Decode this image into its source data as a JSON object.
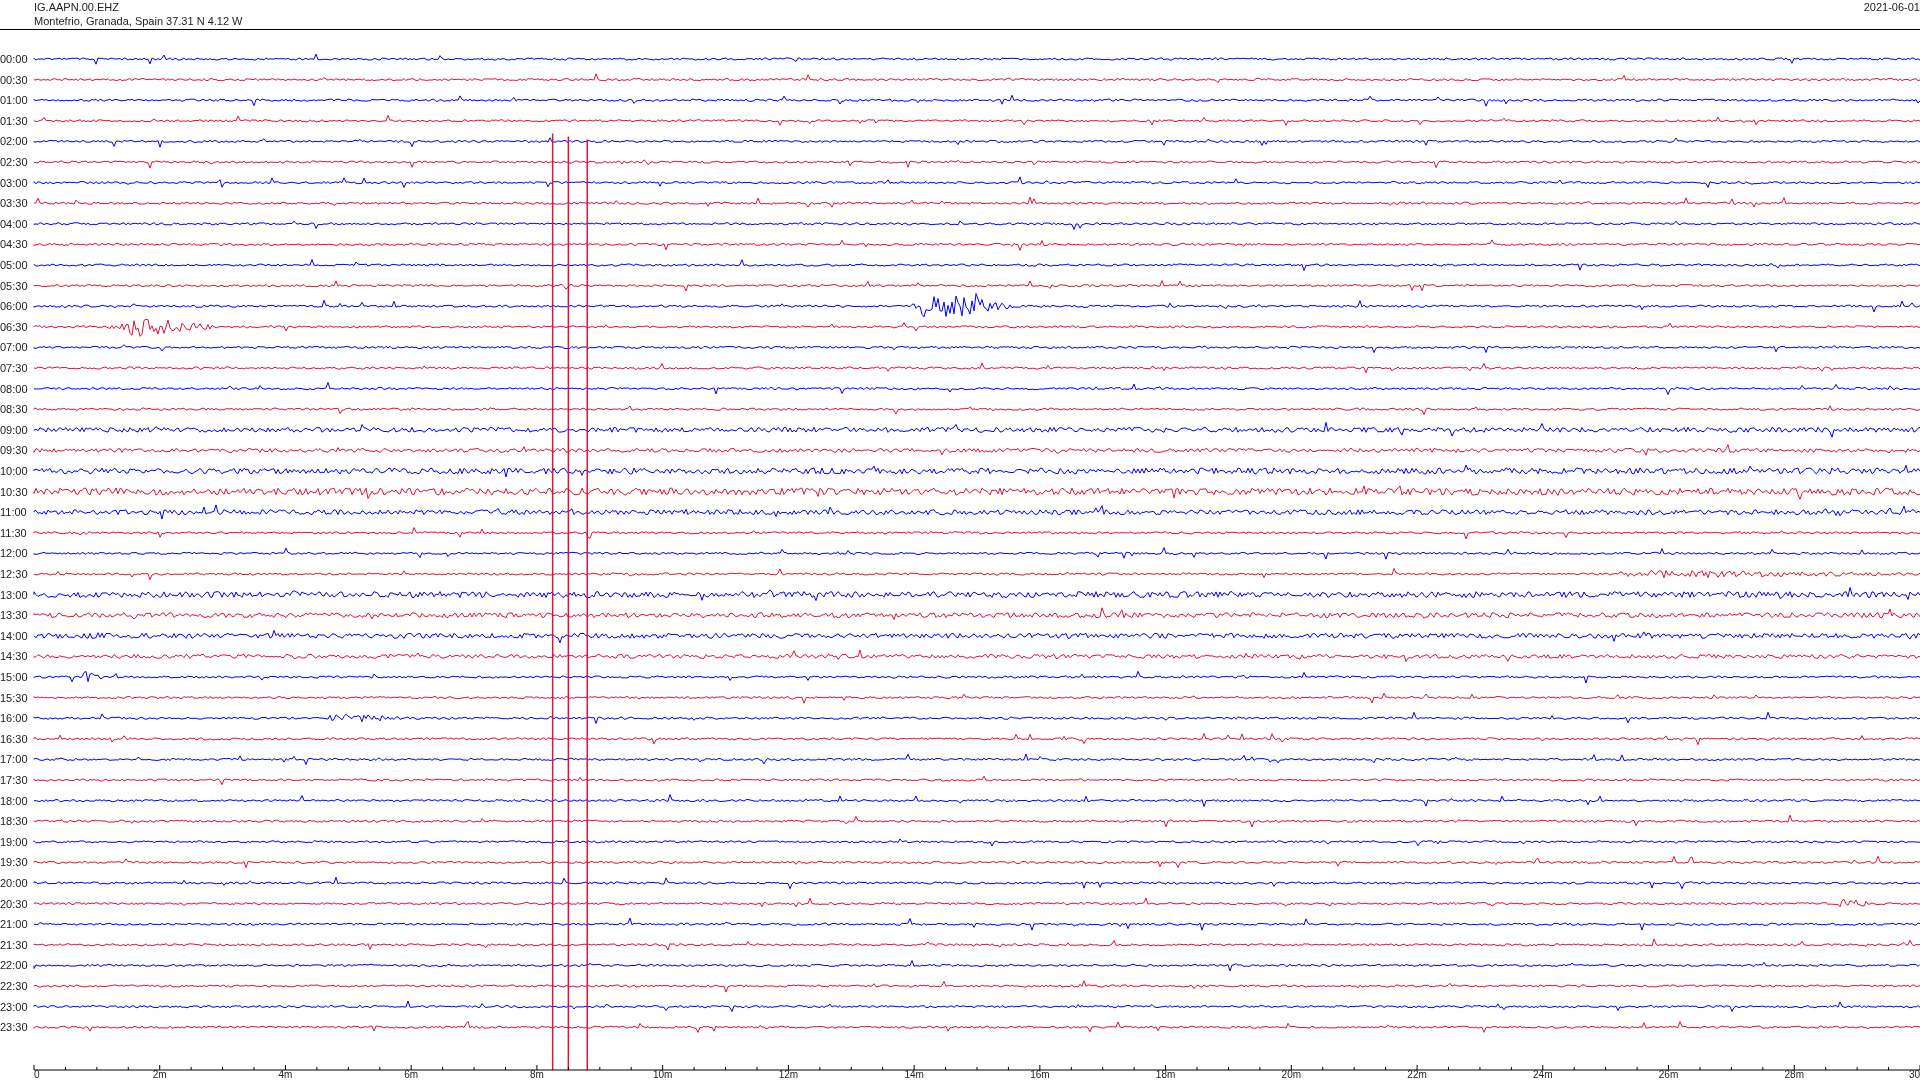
{
  "header": {
    "station": "IG.AAPN.00.EHZ",
    "location": "Montefrio, Granada, Spain  37.31 N 4.12 W",
    "date": "2021-06-01"
  },
  "rows": [
    {
      "time": "00:00",
      "color": "#0000ff"
    },
    {
      "time": "00:30",
      "color": "#dc143c"
    },
    {
      "time": "01:00",
      "color": "#0000ff"
    },
    {
      "time": "01:30",
      "color": "#dc143c"
    },
    {
      "time": "02:00",
      "color": "#0000ff"
    },
    {
      "time": "02:30",
      "color": "#dc143c"
    },
    {
      "time": "03:00",
      "color": "#0000ff"
    },
    {
      "time": "03:30",
      "color": "#dc143c"
    },
    {
      "time": "04:00",
      "color": "#0000ff"
    },
    {
      "time": "04:30",
      "color": "#dc143c"
    },
    {
      "time": "05:00",
      "color": "#0000ff"
    },
    {
      "time": "05:30",
      "color": "#dc143c"
    },
    {
      "time": "06:00",
      "color": "#0000ff"
    },
    {
      "time": "06:30",
      "color": "#dc143c"
    },
    {
      "time": "07:00",
      "color": "#0000ff"
    },
    {
      "time": "07:30",
      "color": "#dc143c"
    },
    {
      "time": "08:00",
      "color": "#0000ff"
    },
    {
      "time": "08:30",
      "color": "#dc143c"
    },
    {
      "time": "09:00",
      "color": "#0000ff"
    },
    {
      "time": "09:30",
      "color": "#dc143c"
    },
    {
      "time": "10:00",
      "color": "#0000ff"
    },
    {
      "time": "10:30",
      "color": "#dc143c"
    },
    {
      "time": "11:00",
      "color": "#0000ff"
    },
    {
      "time": "11:30",
      "color": "#dc143c"
    },
    {
      "time": "12:00",
      "color": "#0000ff"
    },
    {
      "time": "12:30",
      "color": "#dc143c"
    },
    {
      "time": "13:00",
      "color": "#0000ff"
    },
    {
      "time": "13:30",
      "color": "#dc143c"
    },
    {
      "time": "14:00",
      "color": "#0000ff"
    },
    {
      "time": "14:30",
      "color": "#dc143c"
    },
    {
      "time": "15:00",
      "color": "#0000ff"
    },
    {
      "time": "15:30",
      "color": "#dc143c"
    },
    {
      "time": "16:00",
      "color": "#0000ff"
    },
    {
      "time": "16:30",
      "color": "#dc143c"
    },
    {
      "time": "17:00",
      "color": "#0000ff"
    },
    {
      "time": "17:30",
      "color": "#dc143c"
    },
    {
      "time": "18:00",
      "color": "#0000ff"
    },
    {
      "time": "18:30",
      "color": "#dc143c"
    },
    {
      "time": "19:00",
      "color": "#0000ff"
    },
    {
      "time": "19:30",
      "color": "#dc143c"
    },
    {
      "time": "20:00",
      "color": "#0000ff"
    },
    {
      "time": "20:30",
      "color": "#dc143c"
    },
    {
      "time": "21:00",
      "color": "#0000ff"
    },
    {
      "time": "21:30",
      "color": "#dc143c"
    },
    {
      "time": "22:00",
      "color": "#0000ff"
    },
    {
      "time": "22:30",
      "color": "#dc143c"
    },
    {
      "time": "23:00",
      "color": "#0000ff"
    },
    {
      "time": "23:30",
      "color": "#dc143c"
    }
  ],
  "axis_labels": [
    "0",
    "2m",
    "4m",
    "6m",
    "8m",
    "10m",
    "12m",
    "14m",
    "16m",
    "18m",
    "20m",
    "22m",
    "24m",
    "26m",
    "28m",
    "30"
  ]
}
